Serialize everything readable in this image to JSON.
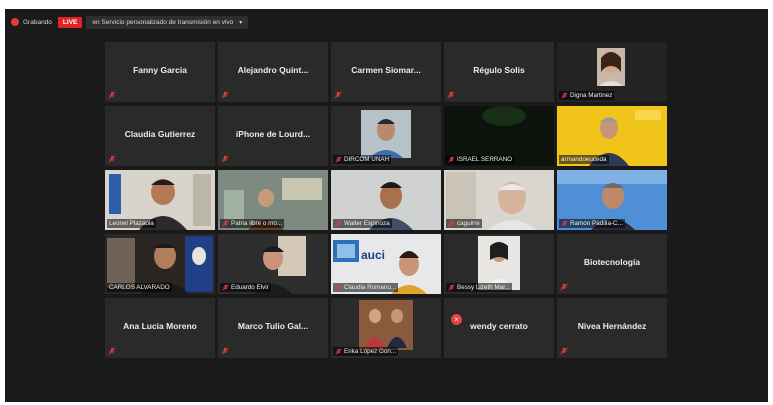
{
  "topbar": {
    "recording_label": "Grabando",
    "live_badge": "LIVE",
    "stream_label": "en Servicio personalizado de transmisión en vivo",
    "stream_chevron": "▾"
  },
  "participants": [
    {
      "name": "Fanny Garcia",
      "muted": true
    },
    {
      "name": "Alejandro  Quint...",
      "muted": true
    },
    {
      "name": "Carmen  Siomar...",
      "muted": true
    },
    {
      "name": "Régulo Solis",
      "muted": true
    },
    {
      "name": "Digna Martinez",
      "muted": true,
      "video": true
    },
    {
      "name": "Claudia Gutierrez",
      "muted": true
    },
    {
      "name": "iPhone de Lourd...",
      "muted": true
    },
    {
      "name": "DIRCOM UNAH",
      "muted": true,
      "video": true
    },
    {
      "name": "ISRAEL SERRANO",
      "muted": true,
      "video": true
    },
    {
      "name": "armandoeuceda",
      "muted": false,
      "video": true
    },
    {
      "name": "Leonel Plazaola",
      "muted": false,
      "video": true
    },
    {
      "name": "Patria libre o mo...",
      "muted": true,
      "video": true
    },
    {
      "name": "Walter Espinoza",
      "muted": true,
      "video": true
    },
    {
      "name": "caguirre",
      "muted": true,
      "video": true
    },
    {
      "name": "Ramón Padilla-C...",
      "muted": true,
      "video": true
    },
    {
      "name": "CARLOS ALVARADO",
      "muted": false,
      "video": true,
      "active_speaker": true
    },
    {
      "name": "Eduardo Elvir",
      "muted": true,
      "video": true
    },
    {
      "name": "Claudia Romano...",
      "muted": true,
      "video": true,
      "logo_text": "auci"
    },
    {
      "name": "Bessy Lizeth Mar...",
      "muted": true,
      "video": true
    },
    {
      "name": "Biotecnología",
      "muted": true
    },
    {
      "name": "Ana Lucia Moreno",
      "muted": true
    },
    {
      "name": "Marco Tulio Gal...",
      "muted": true
    },
    {
      "name": "Erika López Gon...",
      "muted": true,
      "video": true
    },
    {
      "name": "wendy cerrato",
      "muted": false
    },
    {
      "name": "Nivea Hernández",
      "muted": true
    }
  ],
  "colors": {
    "background": "#1a1a1a",
    "tile": "#2a2a2a",
    "live": "#e02424",
    "muted_mic": "#e03c3c",
    "active_border": "#d2e03c"
  }
}
